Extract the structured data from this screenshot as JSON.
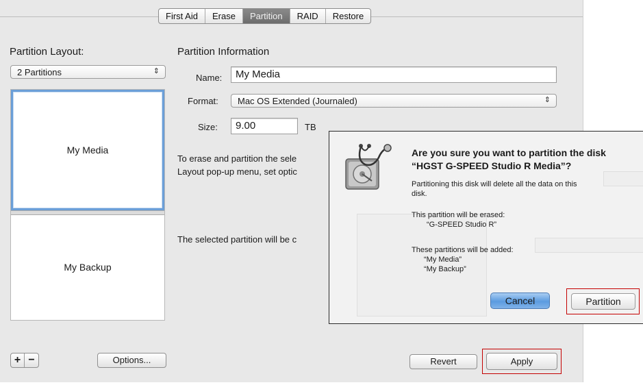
{
  "tabs": [
    "First Aid",
    "Erase",
    "Partition",
    "RAID",
    "Restore"
  ],
  "active_tab": "Partition",
  "layout": {
    "heading": "Partition Layout:",
    "popup_value": "2 Partitions",
    "partitions": [
      "My Media",
      "My Backup"
    ],
    "options_label": "Options..."
  },
  "info": {
    "heading": "Partition Information",
    "name_label": "Name:",
    "name_value": "My Media",
    "format_label": "Format:",
    "format_value": "Mac OS Extended (Journaled)",
    "size_label": "Size:",
    "size_value": "9.00",
    "size_unit": "TB",
    "desc_line1": "To erase and partition the sele",
    "desc_line2": "Layout pop-up menu, set optic",
    "selected_note": "The selected partition will be c"
  },
  "buttons": {
    "revert": "Revert",
    "apply": "Apply",
    "plus": "+",
    "minus": "−"
  },
  "dialog": {
    "title": "Are you sure you want to partition the disk “HGST G-SPEED Studio R Media”?",
    "warning_line1": "Partitioning this disk will delete all the data on this",
    "warning_line2": "disk.",
    "erased_heading": "This partition will be erased:",
    "erased_item": "“G-SPEED Studio R”",
    "added_heading": "These partitions will be added:",
    "added_items": [
      "“My Media”",
      "“My Backup”"
    ],
    "cancel_label": "Cancel",
    "partition_label": "Partition"
  },
  "colors": {
    "highlight_red": "#c40000",
    "selection_blue": "#6b9fd8",
    "default_button_blue": "#5b9be0"
  },
  "icons": {
    "disk_utility": "hard-drive-with-stethoscope-icon",
    "popup_arrows": "up-down-arrows-icon"
  }
}
